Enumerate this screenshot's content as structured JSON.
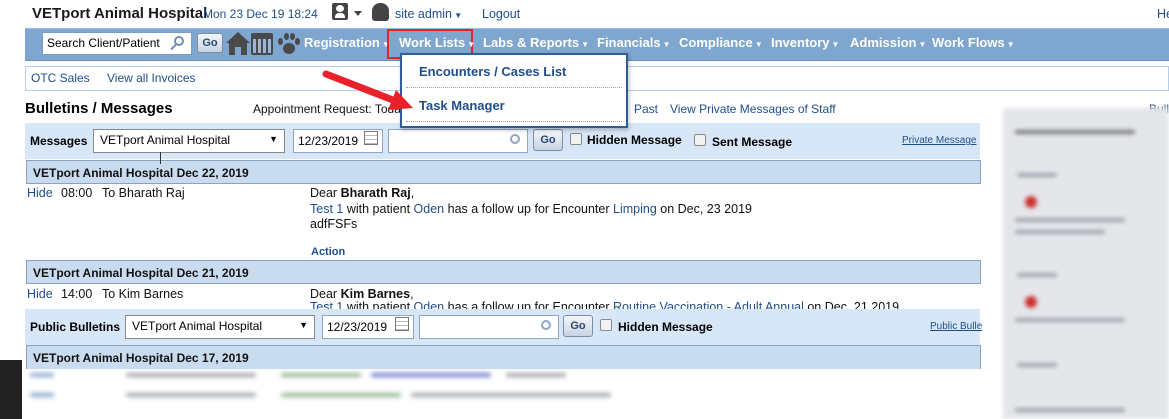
{
  "header": {
    "hospital": "VETport Animal Hospital",
    "datetime": "Mon 23 Dec 19 18:24",
    "user": "site admin",
    "logout": "Logout",
    "help": "He"
  },
  "search": {
    "value": "Search Client/Patient",
    "go": "Go"
  },
  "nav": [
    "Registration",
    "Work Lists",
    "Labs & Reports",
    "Financials",
    "Compliance",
    "Inventory",
    "Admission",
    "Work Flows"
  ],
  "dropdown": [
    "Encounters / Cases List",
    "Task Manager"
  ],
  "subnav": {
    "otc": "OTC Sales",
    "invoices": "View all Invoices"
  },
  "bulletins": {
    "title": "Bulletins / Messages",
    "appt": "Appointment Request: Toda",
    "past": "Past",
    "private_staff": "View Private Messages of Staff",
    "right": "Bull"
  },
  "messages": {
    "label": "Messages",
    "hospital": "VETport Animal Hospital",
    "date": "12/23/2019",
    "go": "Go",
    "hidden": "Hidden Message",
    "sent": "Sent Message",
    "private": "Private Message"
  },
  "entries": [
    {
      "header": "VETport Animal Hospital  Dec 22, 2019",
      "hide": "Hide",
      "time": "08:00",
      "to": "To Bharath Raj",
      "dear": "Dear ",
      "name": "Bharath Raj",
      "comma": ",",
      "test": "Test 1",
      "mid": " with patient ",
      "patient": "Oden",
      "mid2": " has a follow up for Encounter ",
      "encounter": "Limping",
      "date": " on Dec, 23 2019",
      "note": "adfFSFs",
      "action": "Action"
    },
    {
      "header": "VETport Animal Hospital  Dec 21, 2019",
      "hide": "Hide",
      "time": "14:00",
      "to": "To Kim Barnes",
      "dear": "Dear ",
      "name": "Kim Barnes",
      "comma": ",",
      "test": "Test 1",
      "mid": " with patient ",
      "patient": "Oden",
      "mid2": " has a follow up for Encounter ",
      "encounter": "Routine Vaccination - Adult Annual",
      "date": " on Dec, 21 2019"
    }
  ],
  "public": {
    "label": "Public Bulletins",
    "hospital": "VETport Animal Hospital",
    "date": "12/23/2019",
    "go": "Go",
    "hidden": "Hidden Message",
    "link": "Public Bulle"
  },
  "public_header": "VETport Animal Hospital  Dec 17, 2019",
  "colors": {
    "nav": "#7ea6cf",
    "link": "#1f4e8c",
    "highlight": "#e8212a",
    "section": "#c9dcef"
  }
}
